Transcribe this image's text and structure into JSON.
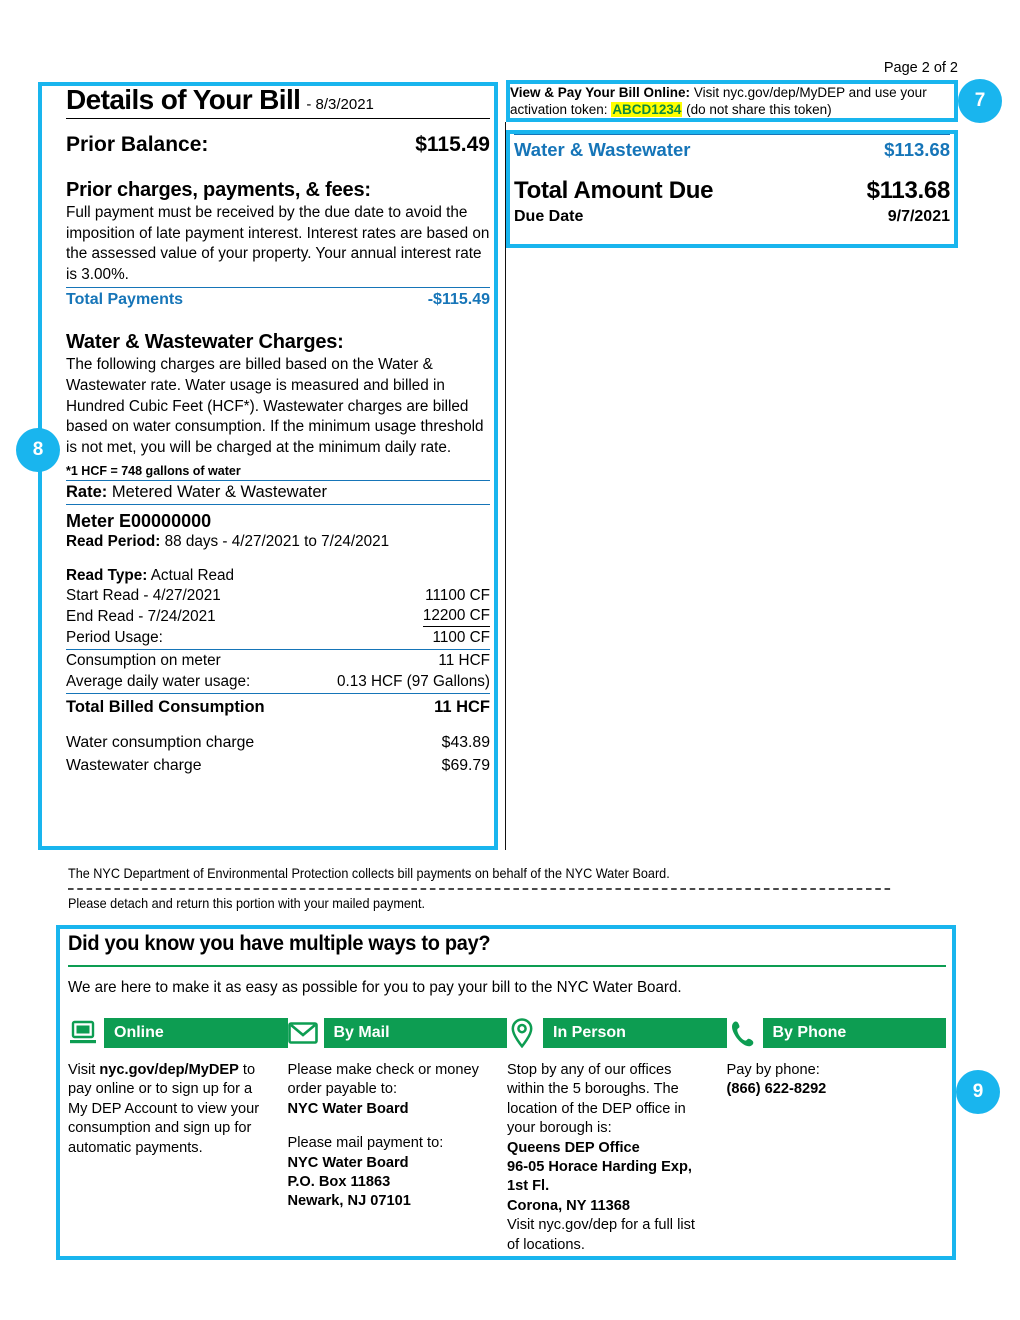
{
  "page_number": "Page 2 of 2",
  "callouts": {
    "token": "7",
    "details": "8",
    "pay": "9"
  },
  "token_strip": {
    "lead": "View & Pay Your Bill Online:",
    "text_before": " Visit nyc.gov/dep/MyDEP and use your activation token: ",
    "token": "ABCD1234",
    "text_after": " (do not share this token)",
    "highlight_color": "#ffff00",
    "token_color": "#108a3d"
  },
  "summary": {
    "service_label": "Water & Wastewater",
    "service_amount": "$113.68",
    "total_label": "Total Amount Due",
    "total_amount": "$113.68",
    "due_label": "Due Date",
    "due_date": "9/7/2021",
    "accent_color": "#1675b8"
  },
  "details": {
    "title": "Details of Your Bill",
    "title_date": "- 8/3/2021",
    "prior_balance_label": "Prior Balance:",
    "prior_balance_value": "$115.49",
    "prior_charges_head": "Prior charges, payments, & fees:",
    "prior_charges_text": "Full payment must be received by the due date to avoid the imposition of late payment interest. Interest rates are based on the assessed value of your property. Your annual interest rate is 3.00%.",
    "total_payments_label": "Total Payments",
    "total_payments_value": "-$115.49",
    "charges_head": "Water & Wastewater Charges:",
    "charges_text": "The following charges are billed based on the Water & Wastewater rate.  Water usage is measured and billed in Hundred Cubic Feet (HCF*).  Wastewater charges are billed based on water consumption.  If the minimum usage threshold is not met, you will be charged at the minimum daily rate.",
    "hcf_footnote": "*1 HCF = 748 gallons of water",
    "rate_label": "Rate:",
    "rate_value": " Metered Water & Wastewater",
    "meter_id": "Meter E00000000",
    "read_period_label": "Read Period:",
    "read_period_value": " 88 days - 4/27/2021 to 7/24/2021",
    "read_type_label": "Read Type:",
    "read_type_value": " Actual Read",
    "meter_rows": [
      {
        "label": "Start Read - 4/27/2021",
        "value": "11100 CF",
        "underline": false
      },
      {
        "label": "End Read - 7/24/2021",
        "value": "12200 CF",
        "underline": true
      },
      {
        "label": "Period Usage:",
        "value": "1100 CF",
        "underline": false
      }
    ],
    "consumption_label": "Consumption on meter",
    "consumption_value": "11 HCF",
    "average_label": "Average daily water usage:",
    "average_value": "0.13 HCF (97 Gallons)",
    "total_billed_label": "Total Billed Consumption",
    "total_billed_value": "11 HCF",
    "charge_rows": [
      {
        "label": "Water consumption charge",
        "value": "$43.89"
      },
      {
        "label": "Wastewater charge",
        "value": "$69.79"
      }
    ]
  },
  "detach": {
    "line1": "The NYC Department of Environmental Protection collects bill payments on behalf of the NYC Water Board.",
    "line2": "Please detach and return this portion with your mailed payment."
  },
  "pay": {
    "title": "Did you know you have multiple ways to pay?",
    "subtitle": "We are here to make it as easy as possible for you to pay your bill to the NYC Water Board.",
    "accent_color": "#0d9d52",
    "columns": [
      {
        "icon": "laptop-icon",
        "label": "Online",
        "paragraphs": [
          [
            {
              "t": "Visit ",
              "b": false
            },
            {
              "t": "nyc.gov/dep/MyDEP",
              "b": true
            },
            {
              "t": " to pay online or to sign up for a My DEP Account to view your consumption and sign up for automatic payments.",
              "b": false
            }
          ]
        ]
      },
      {
        "icon": "envelope-icon",
        "label": "By Mail",
        "paragraphs": [
          [
            {
              "t": "Please make check or money order payable to:\n",
              "b": false
            },
            {
              "t": "NYC Water Board",
              "b": true
            }
          ],
          [
            {
              "t": "Please mail payment to:\n",
              "b": false
            },
            {
              "t": "NYC Water Board\nP.O. Box 11863\nNewark, NJ 07101",
              "b": true
            }
          ]
        ]
      },
      {
        "icon": "map-pin-icon",
        "label": "In Person",
        "paragraphs": [
          [
            {
              "t": "Stop by any of our offices within the 5 boroughs. The location of the DEP office in your borough is:\n",
              "b": false
            },
            {
              "t": "Queens DEP Office\n96-05 Horace Harding Exp, 1st Fl.\nCorona, NY 11368\n",
              "b": true
            },
            {
              "t": "Visit nyc.gov/dep for a full list of locations.",
              "b": false
            }
          ]
        ]
      },
      {
        "icon": "phone-icon",
        "label": "By Phone",
        "paragraphs": [
          [
            {
              "t": "Pay by phone:\n",
              "b": false
            },
            {
              "t": "(866) 622-8292",
              "b": true
            }
          ]
        ]
      }
    ]
  }
}
